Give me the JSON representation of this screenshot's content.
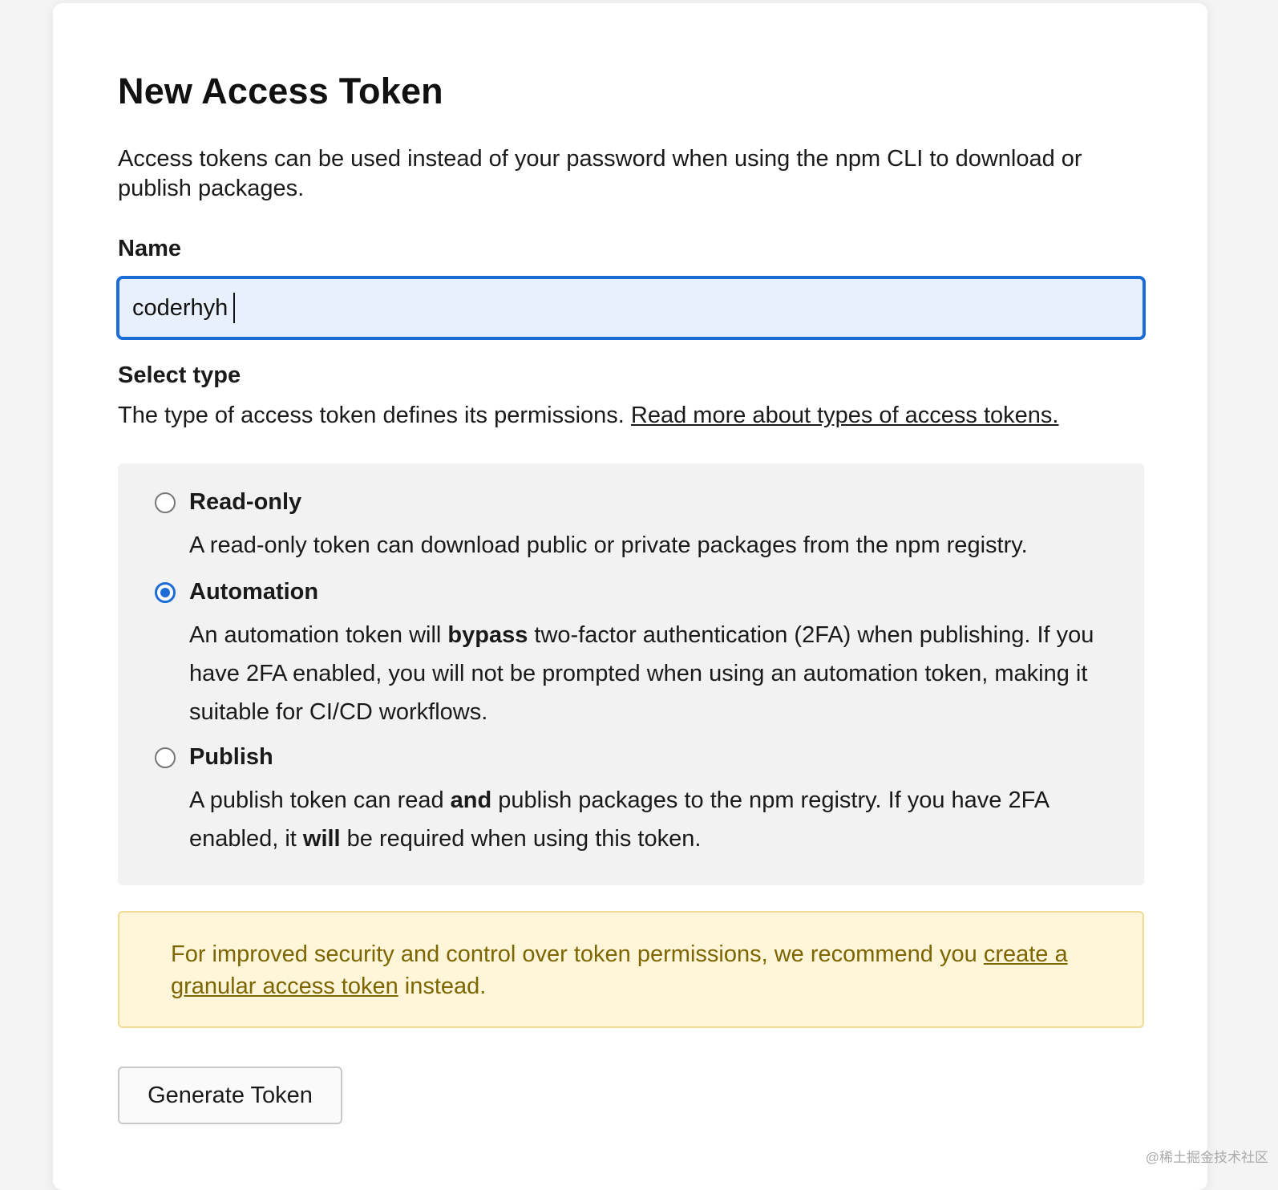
{
  "page": {
    "title": "New Access Token",
    "intro": "Access tokens can be used instead of your password when using the npm CLI to download or publish packages."
  },
  "name_field": {
    "label": "Name",
    "value": "coderhyh"
  },
  "type_section": {
    "label": "Select type",
    "description": "The type of access token defines its permissions.",
    "link_text": "Read more about types of access tokens."
  },
  "options": [
    {
      "title": "Read-only",
      "checked": false,
      "desc_parts": [
        "A read-only token can download public or private packages from the npm registry."
      ]
    },
    {
      "title": "Automation",
      "checked": true,
      "desc_parts": [
        "An automation token will ",
        "bypass",
        " two-factor authentication (2FA) when publishing. If you have 2FA enabled, you will not be prompted when using an automation token, making it suitable for CI/CD workflows."
      ]
    },
    {
      "title": "Publish",
      "checked": false,
      "desc_parts": [
        "A publish token can read ",
        "and",
        " publish packages to the npm registry. If you have 2FA enabled, it ",
        "will",
        " be required when using this token."
      ]
    }
  ],
  "notice": {
    "text_before": "For improved security and control over token permissions, we recommend you ",
    "link_text": "create a granular access token",
    "text_after": " instead."
  },
  "generate_button": {
    "label": "Generate Token"
  },
  "watermark": "@稀土掘金技术社区",
  "colors": {
    "accent": "#1c6cd8",
    "input_bg": "#e8f0fe",
    "notice_bg": "#fff6da",
    "notice_text": "#7d6500",
    "options_bg": "#f2f2f2"
  }
}
